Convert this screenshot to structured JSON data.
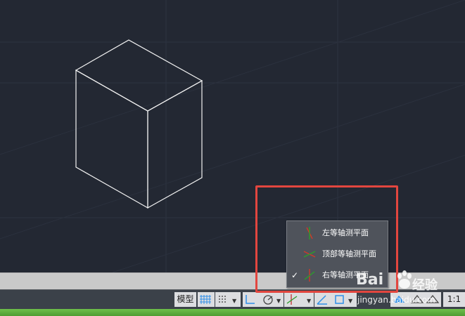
{
  "status_bar": {
    "model_label": "模型",
    "scale_label": "1:1",
    "dropdown_arrow": "▼"
  },
  "isoplane_menu": {
    "items": [
      {
        "label": "左等轴测平面",
        "checked": false
      },
      {
        "label": "顶部等轴测平面",
        "checked": false
      },
      {
        "label": "右等轴测平面",
        "checked": true
      }
    ],
    "check_glyph": "✓"
  },
  "watermark": {
    "brand": "Bai",
    "brand_suffix": "经验",
    "url": "jingyan.baidu.com"
  },
  "colors": {
    "canvas": "#232833",
    "highlight": "#e2463f",
    "menu_bg": "#4f535b",
    "accent_blue": "#2f8fe8"
  }
}
